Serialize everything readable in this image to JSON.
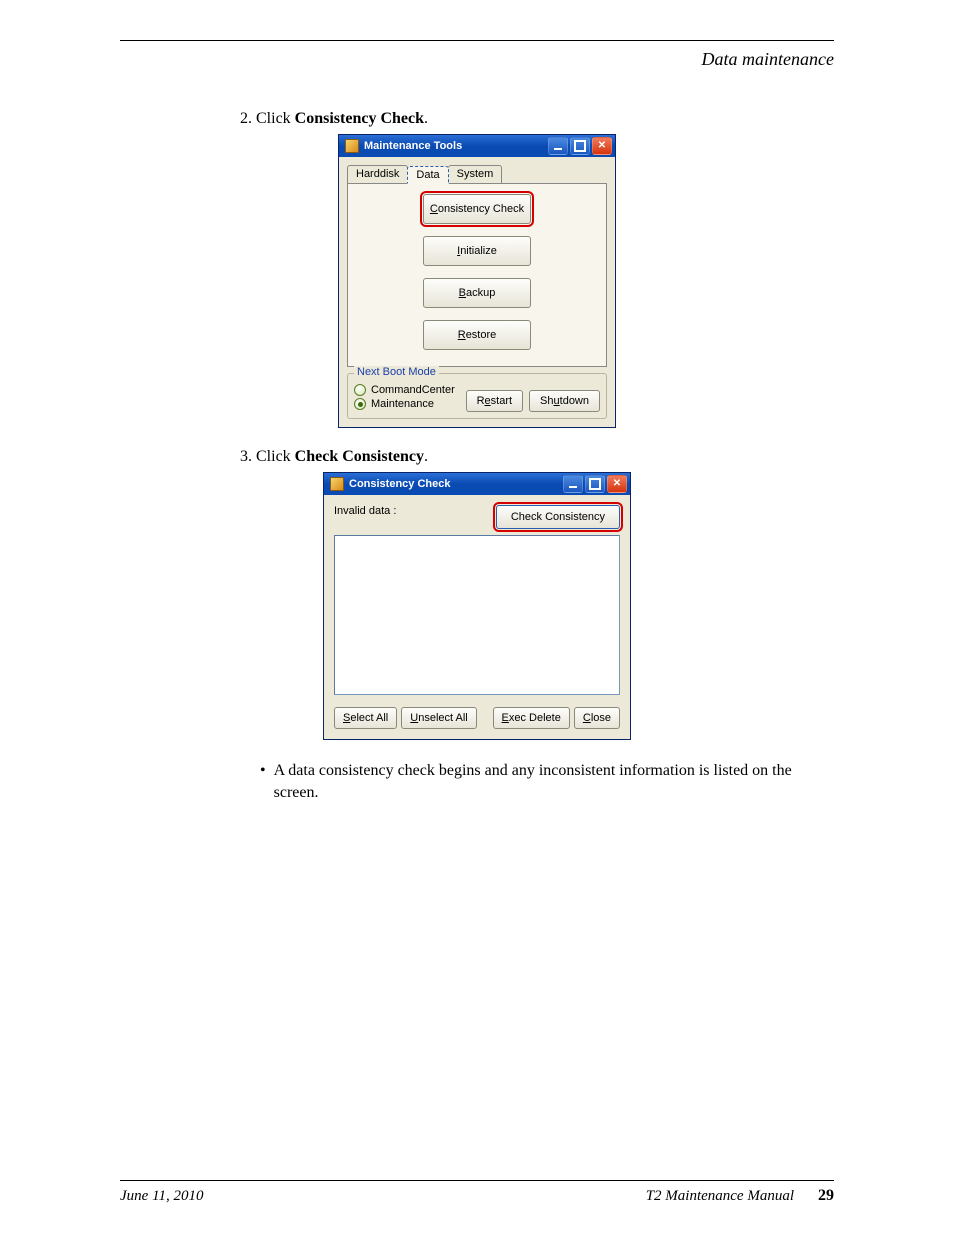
{
  "header": {
    "section_title": "Data maintenance"
  },
  "steps": {
    "s2": {
      "num": "2.",
      "prefix": "Click ",
      "bold": "Consistency Check",
      "suffix": "."
    },
    "s3": {
      "num": "3.",
      "prefix": "Click ",
      "bold": "Check Consistency",
      "suffix": "."
    }
  },
  "bullet": {
    "dot": "•",
    "text": "A data consistency check begins and any inconsistent information is listed on the screen."
  },
  "dialog1": {
    "title": "Maintenance Tools",
    "tabs": {
      "t0": "Harddisk",
      "t1": "Data",
      "t2": "System"
    },
    "buttons": {
      "consistency": {
        "ul": "C",
        "rest": "onsistency Check"
      },
      "initialize": {
        "ul": "I",
        "rest": "nitialize"
      },
      "backup": {
        "ul": "B",
        "rest": "ackup"
      },
      "restore": {
        "ul": "R",
        "rest": "estore"
      }
    },
    "group": {
      "legend": "Next Boot Mode",
      "opt0": "CommandCenter",
      "opt1": "Maintenance"
    },
    "restart": {
      "pre": "R",
      "ul": "e",
      "post": "start"
    },
    "shutdown": {
      "pre": "Sh",
      "ul": "u",
      "post": "tdown"
    }
  },
  "dialog2": {
    "title": "Consistency Check",
    "invalid_label": "Invalid data :",
    "check_btn": {
      "pre": "C",
      "ul": "h",
      "post": "eck Consistency"
    },
    "select_all": {
      "ul": "S",
      "rest": "elect All"
    },
    "unselect_all": {
      "ul": "U",
      "rest": "nselect All"
    },
    "exec_delete": {
      "ul": "E",
      "rest": "xec Delete"
    },
    "close": {
      "ul": "C",
      "rest": "lose"
    }
  },
  "footer": {
    "date": "June 11, 2010",
    "manual": "T2 Maintenance Manual",
    "page": "29"
  }
}
